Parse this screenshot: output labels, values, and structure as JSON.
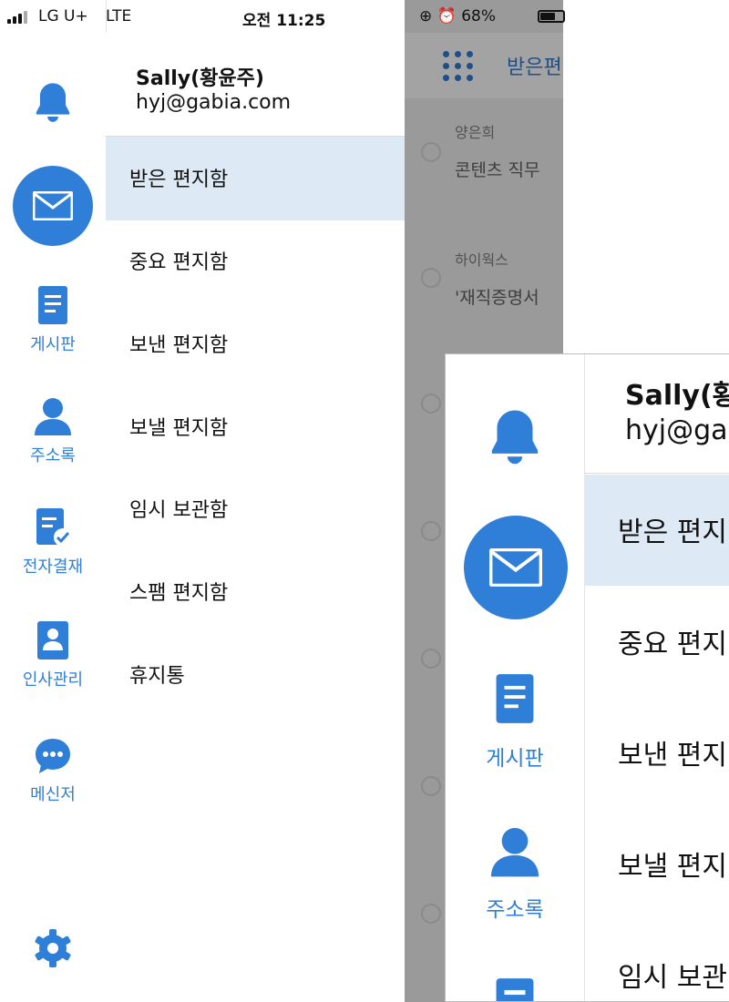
{
  "status_bar": {
    "carrier": "LG U+",
    "network": "LTE",
    "time": "오전 11:25",
    "battery": "68%",
    "battery_level": 0.68
  },
  "rail": {
    "items": [
      {
        "id": "notifications",
        "icon": "bell-icon",
        "label": ""
      },
      {
        "id": "mail",
        "icon": "mail-icon",
        "label": ""
      },
      {
        "id": "board",
        "icon": "document-icon",
        "label": "게시판"
      },
      {
        "id": "contacts",
        "icon": "person-icon",
        "label": "주소록"
      },
      {
        "id": "approval",
        "icon": "approval-document-icon",
        "label": "전자결재"
      },
      {
        "id": "hr",
        "icon": "id-badge-icon",
        "label": "인사관리"
      },
      {
        "id": "messenger",
        "icon": "chat-bubble-icon",
        "label": "메신저"
      },
      {
        "id": "settings",
        "icon": "gear-icon",
        "label": ""
      }
    ]
  },
  "drawer": {
    "account": {
      "name": "Sally(황윤주)",
      "email": "hyj@gabia.com"
    },
    "menu": [
      {
        "label": "받은 편지함",
        "active": true
      },
      {
        "label": "중요 편지함",
        "active": false
      },
      {
        "label": "보낸 편지함",
        "active": false
      },
      {
        "label": "보낼 편지함",
        "active": false
      },
      {
        "label": "임시 보관함",
        "active": false
      },
      {
        "label": "스팸 편지함",
        "active": false
      },
      {
        "label": "휴지통",
        "active": false
      }
    ]
  },
  "background": {
    "header_title": "받은편",
    "rows": [
      {
        "sender": "양은희",
        "subject": "콘텐츠 직무"
      },
      {
        "sender": "하이웍스",
        "subject": "'재직증명서"
      }
    ]
  },
  "inset": {
    "account_name": "Sally(황",
    "account_email": "hyj@ga",
    "menu": [
      "받은 편지",
      "중요 편지",
      "보낸 편지",
      "보낼 편지",
      "임시 보관"
    ],
    "labels": {
      "board": "게시판",
      "contacts": "주소록"
    }
  },
  "colors": {
    "accent": "#2f7fd9",
    "active_bg": "#dde9f5",
    "overlay": "#9a9a9a",
    "header_text": "#1f4f86"
  }
}
